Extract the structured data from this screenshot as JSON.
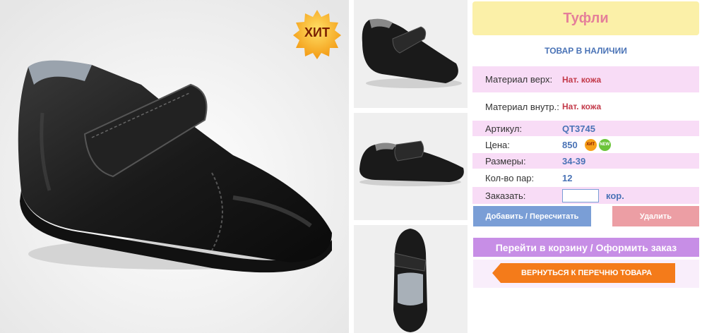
{
  "product": {
    "title": "Туфли",
    "stock_status": "ТОВАР В НАЛИЧИИ",
    "hit_badge": "ХИТ"
  },
  "details": {
    "upper_material_label": "Материал верх:",
    "upper_material_value": "Нат. кожа",
    "lining_material_label": "Материал внутр.:",
    "lining_material_value": "Нат. кожа",
    "article_label": "Артикул:",
    "article_value": "QT3745",
    "price_label": "Цена:",
    "price_value": "850",
    "price_badge_hit": "ХИТ",
    "price_badge_new": "NEW",
    "sizes_label": "Размеры:",
    "sizes_value": "34-39",
    "pairs_label": "Кол-во пар:",
    "pairs_value": "12",
    "order_label": "Заказать:",
    "order_input_value": "",
    "order_unit": "кор."
  },
  "buttons": {
    "add_recalc": "Добавить / Пересчитать",
    "delete": "Удалить",
    "go_to_cart": "Перейти в корзину / Оформить заказ",
    "return_to_list": "ВЕРНУТЬСЯ К ПЕРЕЧНЮ ТОВАРА"
  },
  "colors": {
    "title_bg": "#fbf0a8",
    "title_text": "#e57f9a",
    "link_blue": "#4a73b6",
    "material_red": "#c33a4a",
    "row_pink": "#f8dcf6",
    "add_button": "#7a9ed6",
    "delete_button": "#ec9ea4",
    "cart_button": "#c78ee6",
    "return_button": "#f47b1a"
  }
}
